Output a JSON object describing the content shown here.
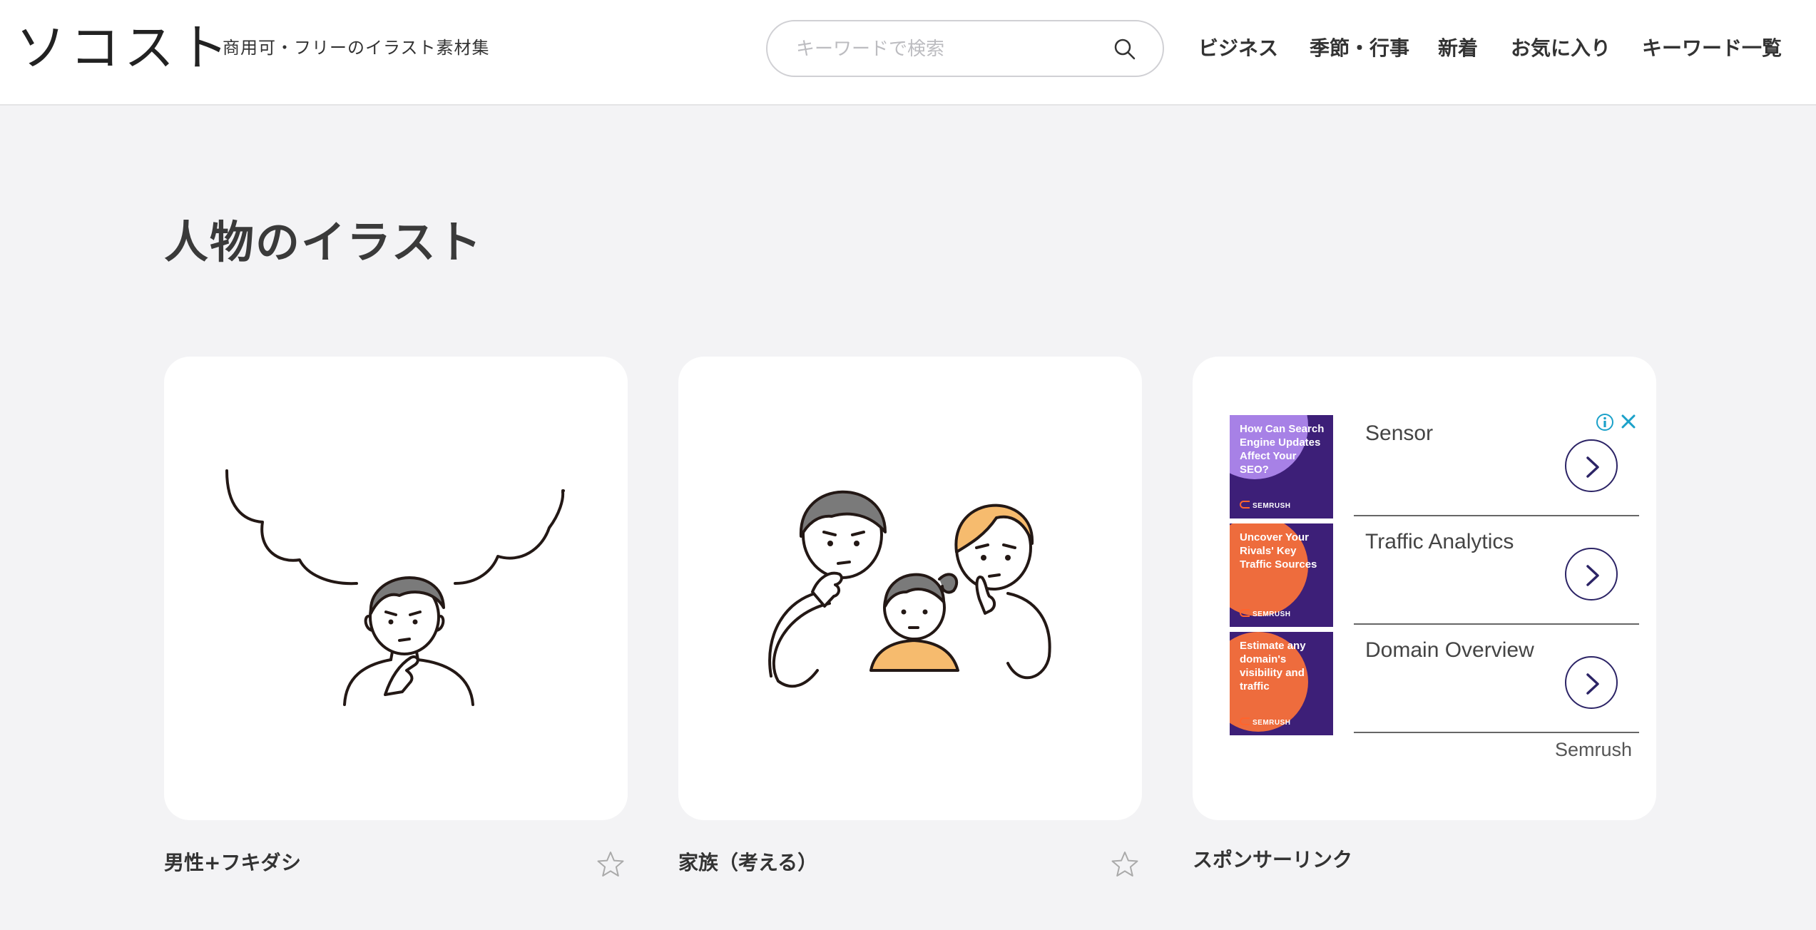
{
  "header": {
    "logo": "ソコスト",
    "tagline": "商用可・フリーのイラスト素材集",
    "search_placeholder": "キーワードで検索",
    "nav": [
      "ビジネス",
      "季節・行事",
      "新着",
      "お気に入り",
      "キーワード一覧"
    ]
  },
  "page_title": "人物のイラスト",
  "cards": [
    {
      "caption": "男性+フキダシ"
    },
    {
      "caption": "家族（考える）"
    }
  ],
  "ad": {
    "label": "スポンサーリンク",
    "advertiser": "Semrush",
    "items": [
      {
        "title": "Sensor",
        "thumb_text": "How Can Search Engine Updates Affect Your SEO?",
        "thumb_brand": "SEMRUSH"
      },
      {
        "title": "Traffic Analytics",
        "thumb_text": "Uncover Your Rivals' Key Traffic Sources",
        "thumb_brand": "SEMRUSH"
      },
      {
        "title": "Domain Overview",
        "thumb_text": "Estimate any domain's visibility and traffic",
        "thumb_brand": "SEMRUSH"
      }
    ]
  },
  "colors": {
    "background": "#f3f3f5",
    "text": "#333333",
    "ad_purple": "#3d1f78",
    "ad_orange": "#ee6c3d",
    "ad_lilac": "#a781e6",
    "hair_gray": "#7a7a7a",
    "hair_blond": "#f6bb6e"
  }
}
